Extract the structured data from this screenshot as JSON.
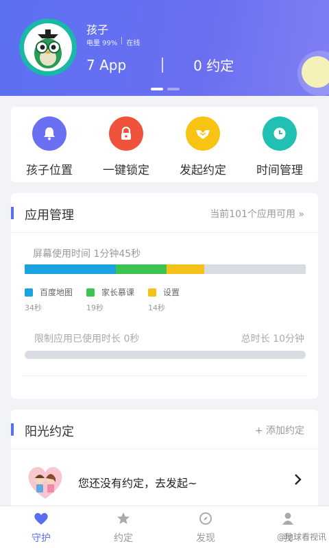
{
  "header": {
    "child_name": "孩子",
    "battery": "电量 99%",
    "online": "在线",
    "app_count": "7 App",
    "agreement_count": "0 约定"
  },
  "quick_actions": [
    {
      "label": "孩子位置",
      "icon": "bell-icon",
      "color": "#6b6ff2"
    },
    {
      "label": "一键锁定",
      "icon": "lock-icon",
      "color": "#f0533b"
    },
    {
      "label": "发起约定",
      "icon": "handshake-icon",
      "color": "#f7c413"
    },
    {
      "label": "时间管理",
      "icon": "clock-icon",
      "color": "#20c0b3"
    }
  ],
  "app_management": {
    "title": "应用管理",
    "link": "当前101个应用可用 »",
    "screen_time": "屏幕使用时间 1分钟45秒",
    "usage": [
      {
        "name": "百度地图",
        "time": "34秒",
        "seconds": 34,
        "color": "#1aa3e0"
      },
      {
        "name": "家长慕课",
        "time": "19秒",
        "seconds": 19,
        "color": "#3dc450"
      },
      {
        "name": "设置",
        "time": "14秒",
        "seconds": 14,
        "color": "#f4c01a"
      }
    ],
    "total_seconds": 105,
    "limit_used": "限制应用已使用时长 0秒",
    "limit_total": "总时长 10分钟"
  },
  "agreement": {
    "title": "阳光约定",
    "add_label": "+ 添加约定",
    "empty_text": "您还没有约定，去发起~"
  },
  "nav": [
    {
      "label": "守护",
      "icon": "heart-icon",
      "active": true
    },
    {
      "label": "约定",
      "icon": "star-icon",
      "active": false
    },
    {
      "label": "发现",
      "icon": "compass-icon",
      "active": false
    },
    {
      "label": "我",
      "icon": "person-icon",
      "active": false
    }
  ],
  "watermark": "@地球看视讯",
  "colors": {
    "accent": "#5a6ff0"
  }
}
